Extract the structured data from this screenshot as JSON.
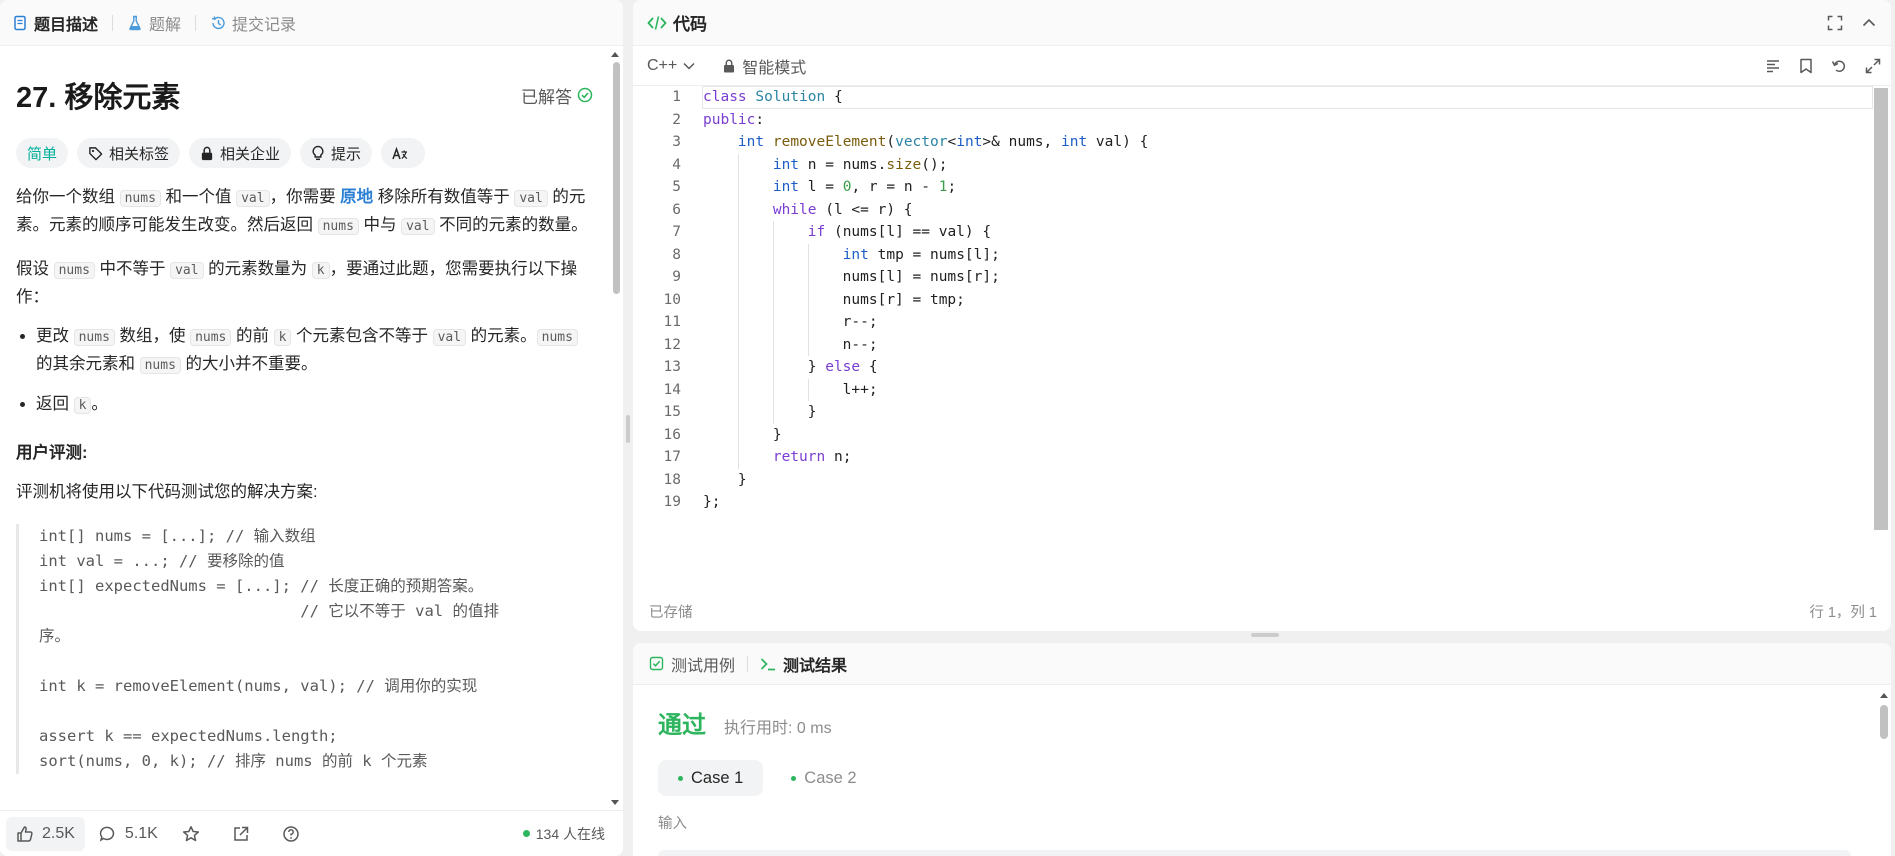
{
  "left": {
    "tabs": [
      {
        "label": "题目描述"
      },
      {
        "label": "题解"
      },
      {
        "label": "提交记录"
      }
    ],
    "title": "27. 移除元素",
    "solved_label": "已解答",
    "tags": [
      {
        "label": "简单"
      },
      {
        "label": "相关标签"
      },
      {
        "label": "相关企业"
      },
      {
        "label": "提示"
      },
      {
        "label": "Aあ"
      }
    ],
    "p1": {
      "t1": "给你一个数组 ",
      "c1": "nums",
      "t2": " 和一个值 ",
      "c2": "val",
      "t3": "，你需要 ",
      "hl": "原地",
      "t4": " 移除所有数值等于 ",
      "c3": "val",
      "t5": " 的元素。元素的顺序可能发生改变。然后返回 ",
      "c4": "nums",
      "t6": " 中与 ",
      "c5": "val",
      "t7": " 不同的元素的数量。"
    },
    "p2": {
      "t1": "假设 ",
      "c1": "nums",
      "t2": " 中不等于 ",
      "c2": "val",
      "t3": " 的元素数量为 ",
      "c3": "k",
      "t4": "，要通过此题，您需要执行以下操作："
    },
    "b1": {
      "t1": "更改 ",
      "c1": "nums",
      "t2": " 数组，使 ",
      "c2": "nums",
      "t3": " 的前 ",
      "c3": "k",
      "t4": " 个元素包含不等于 ",
      "c4": "val",
      "t5": " 的元素。",
      "c5": "nums",
      "t6": " 的其余元素和 ",
      "c6": "nums",
      "t7": " 的大小并不重要。"
    },
    "b2": {
      "t1": "返回 ",
      "c1": "k",
      "t2": "。"
    },
    "judge_title": "用户评测:",
    "judge_desc": "评测机将使用以下代码测试您的解决方案:",
    "judge_code": [
      "int[] nums = [...]; // 输入数组",
      "int val = ...; // 要移除的值",
      "int[] expectedNums = [...]; // 长度正确的预期答案。",
      "                            // 它以不等于 val 的值排",
      "序。",
      "",
      "int k = removeElement(nums, val); // 调用你的实现",
      "",
      "assert k == expectedNums.length;",
      "sort(nums, 0, k); // 排序 nums 的前 k 个元素"
    ],
    "footer": {
      "likes": "2.5K",
      "comments": "5.1K",
      "online": "134 人在线"
    }
  },
  "code": {
    "title": "代码",
    "language": "C++",
    "mode": "智能模式",
    "status": "已存储",
    "cursor": "行 1，列 1",
    "lines": [
      "1",
      "2",
      "3",
      "4",
      "5",
      "6",
      "7",
      "8",
      "9",
      "10",
      "11",
      "12",
      "13",
      "14",
      "15",
      "16",
      "17",
      "18",
      "19"
    ]
  },
  "test": {
    "tab_cases": "测试用例",
    "tab_results": "测试结果",
    "result": "通过",
    "runtime": "执行用时: 0 ms",
    "cases": [
      {
        "label": "Case 1"
      },
      {
        "label": "Case 2"
      }
    ],
    "input_label": "输入"
  },
  "colors": {
    "accent_green": "#2db55d",
    "easy": "#00af9b",
    "highlight_blue": "#2b7fd4"
  }
}
